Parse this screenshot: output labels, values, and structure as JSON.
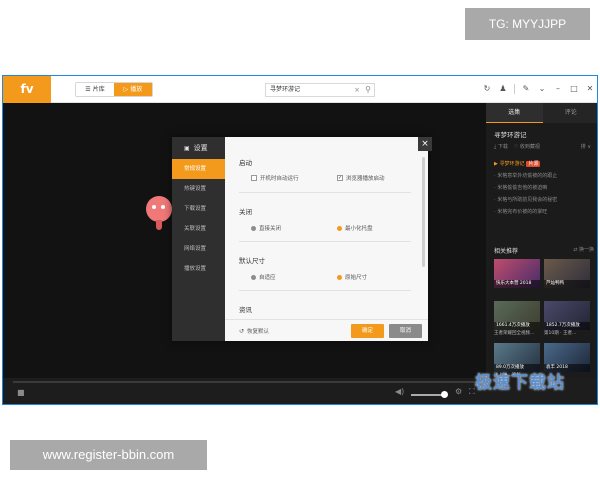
{
  "watermarks": {
    "telegram": "TG: MYYJJPP",
    "url": "www.register-bbin.com",
    "site": "极速下载站"
  },
  "colors": {
    "accent": "#f39a1c",
    "dark_bg": "#121212",
    "badge": "#e04a2a"
  },
  "app": {
    "logo_text": "fv",
    "tabs": [
      {
        "label": "片库",
        "icon": "list-icon",
        "active": false
      },
      {
        "label": "播放",
        "icon": "play-icon",
        "active": true
      }
    ],
    "search_value": "寻梦环游记",
    "window_icons": [
      "refresh-icon",
      "user-icon",
      "edit-icon",
      "chevron-down-icon",
      "minimize-icon",
      "maximize-icon",
      "close-icon"
    ]
  },
  "panel": {
    "tabs": [
      "选集",
      "评论"
    ],
    "active_tab": "选集",
    "title": "寻梦环游记",
    "download_label": "下载",
    "favorite_label": "收到藏视",
    "sort_label": "排 ∨",
    "episodes": [
      {
        "label": "寻梦环游记",
        "badge": "片源",
        "active": true
      },
      {
        "label": "米格意举外坊偷被的的跟止",
        "active": false
      },
      {
        "label": "米格偷偷吉他的被迫嘛",
        "active": false
      },
      {
        "label": "米格与所助前见我会的秘密",
        "active": false
      },
      {
        "label": "米格完布价被的的掌旺",
        "active": false
      }
    ],
    "recommend_title": "相关推荐",
    "recommend_more": "换一换",
    "thumbs": [
      {
        "overlay": "快乐大本营 2018",
        "caption": ""
      },
      {
        "overlay": "芦灿鸭鸭",
        "caption": ""
      },
      {
        "overlay": "1661.4万次播放",
        "caption": "王者荣耀回全视频..."
      },
      {
        "overlay": "1852.7万次播放",
        "caption": "第10期 · 王者..."
      },
      {
        "overlay": "89.0万次播放",
        "caption": "迷上谁...神秘"
      },
      {
        "overlay": "袁丰 2018",
        "caption": ""
      }
    ]
  },
  "dialog": {
    "title": "设置",
    "title_icon": "settings-icon",
    "nav": [
      {
        "label": "常规设置",
        "active": true
      },
      {
        "label": "热键设置",
        "active": false
      },
      {
        "label": "下载设置",
        "active": false
      },
      {
        "label": "关联设置",
        "active": false
      },
      {
        "label": "网络设置",
        "active": false
      },
      {
        "label": "播放设置",
        "active": false
      }
    ],
    "sections": {
      "startup": {
        "title": "启动",
        "options": [
          {
            "label": "开机时自动运行",
            "checked": false
          },
          {
            "label": "浏览器播放启动",
            "checked": true
          }
        ]
      },
      "close": {
        "title": "关闭",
        "options": [
          {
            "label": "直接关闭",
            "selected": false
          },
          {
            "label": "最小化托盘",
            "selected": true
          }
        ]
      },
      "size": {
        "title": "默认尺寸",
        "options": [
          {
            "label": "自适应",
            "selected": false
          },
          {
            "label": "原始尺寸",
            "selected": true
          }
        ]
      },
      "info": {
        "title": "资讯"
      }
    },
    "restore_label": "恢复默认",
    "ok_label": "确定",
    "cancel_label": "取消"
  }
}
